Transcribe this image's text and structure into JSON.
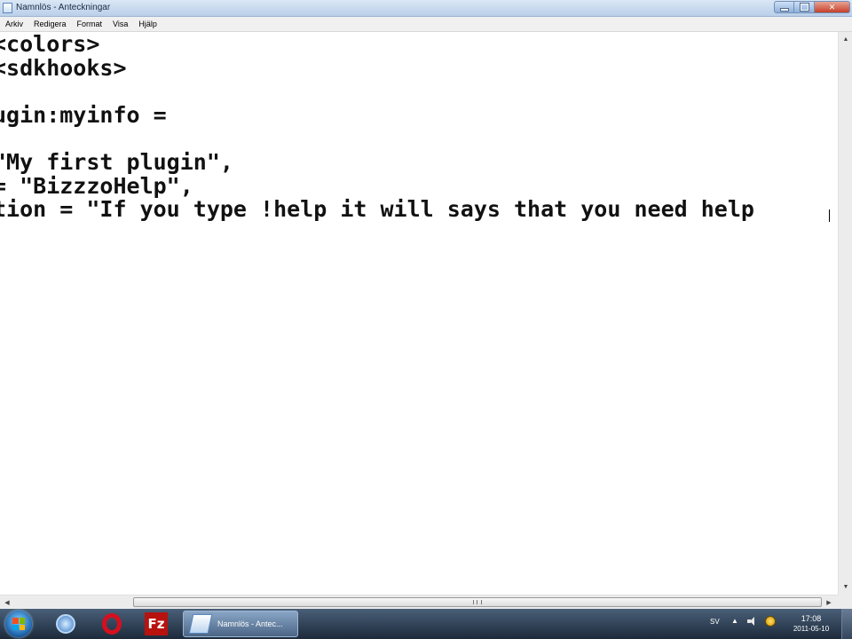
{
  "window": {
    "title": "Namnlös - Anteckningar"
  },
  "menu": [
    "Arkiv",
    "Redigera",
    "Format",
    "Visa",
    "Hjälp"
  ],
  "editor": {
    "lines": [
      "<colors>",
      "<sdkhooks>",
      "",
      "ugin:myinfo =",
      "",
      "\"My first plugin\",",
      "= \"BizzzoHelp\",",
      "tion = \"If you type !help it will says that you need help"
    ]
  },
  "taskbar": {
    "task_label": "Namnlös - Antec...",
    "language": "SV",
    "time": "17:08",
    "date": "2011-05-10"
  },
  "icons": {
    "app": "notepad-icon",
    "start": "windows-start-orb",
    "browser": "internet-explorer-icon",
    "opera": "opera-icon",
    "ftp": "filezilla-icon"
  }
}
